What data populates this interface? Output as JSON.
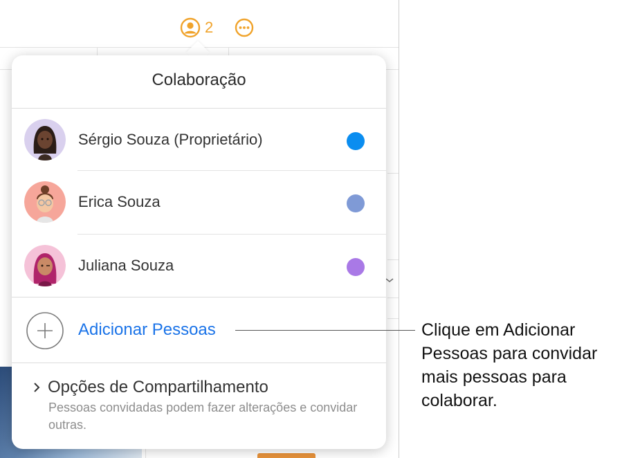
{
  "toolbar": {
    "collab_count": "2",
    "icon_collab": "person-circle-icon",
    "icon_more": "ellipsis-circle-icon",
    "accent": "#f0a32b"
  },
  "popover": {
    "title": "Colaboração",
    "participants": [
      {
        "name": "Sérgio Souza (Proprietário)",
        "color": "#0a8df0",
        "avatar_bg": "#d9d0ee"
      },
      {
        "name": "Erica Souza",
        "color": "#7f9ad6",
        "avatar_bg": "#f6a69a"
      },
      {
        "name": "Juliana Souza",
        "color": "#a979e6",
        "avatar_bg": "#f5c2d8"
      }
    ],
    "add_people": {
      "label": "Adicionar Pessoas",
      "icon": "plus-circle-icon"
    },
    "share_options": {
      "title": "Opções de Compartilhamento",
      "description": "Pessoas convidadas podem fazer alterações e convidar outras.",
      "icon": "chevron-right-icon"
    }
  },
  "callout": {
    "text": "Clique em Adicionar Pessoas para convidar mais pessoas para colaborar."
  }
}
